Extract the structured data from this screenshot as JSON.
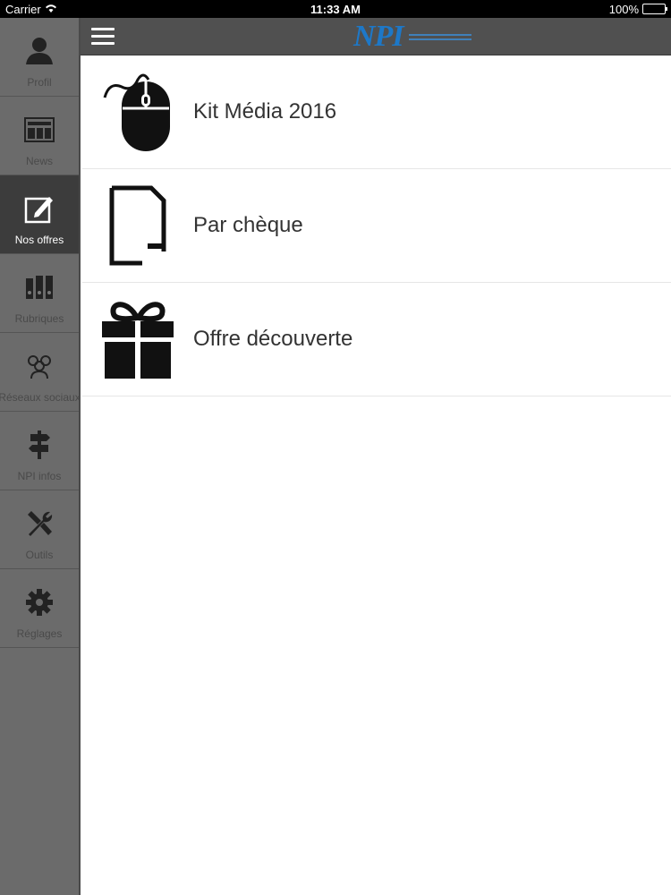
{
  "status": {
    "carrier": "Carrier",
    "time": "11:33 AM",
    "battery": "100%"
  },
  "header": {
    "logo_text": "NPI"
  },
  "sidebar": {
    "items": [
      {
        "label": "Profil",
        "icon": "user-icon"
      },
      {
        "label": "News",
        "icon": "newspaper-icon"
      },
      {
        "label": "Nos offres",
        "icon": "edit-icon",
        "active": true
      },
      {
        "label": "Rubriques",
        "icon": "binders-icon"
      },
      {
        "label": "Réseaux sociaux",
        "icon": "people-icon"
      },
      {
        "label": "NPI infos",
        "icon": "signpost-icon"
      },
      {
        "label": "Outils",
        "icon": "tools-icon"
      },
      {
        "label": "Réglages",
        "icon": "gear-icon"
      }
    ]
  },
  "offers": {
    "items": [
      {
        "label": "Kit Média 2016",
        "icon": "mouse-icon"
      },
      {
        "label": "Par chèque",
        "icon": "document-icon"
      },
      {
        "label": "Offre découverte",
        "icon": "gift-icon"
      }
    ]
  }
}
